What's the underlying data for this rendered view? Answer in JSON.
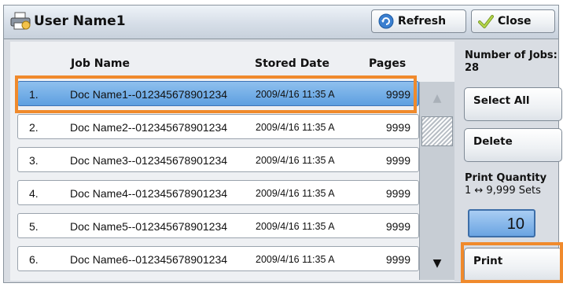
{
  "window": {
    "title": "User Name1"
  },
  "toolbar": {
    "refresh_label": "Refresh",
    "close_label": "Close"
  },
  "table": {
    "columns": {
      "job_name": "Job Name",
      "stored_date": "Stored Date",
      "pages": "Pages"
    },
    "rows": [
      {
        "num": "1.",
        "name": "Doc Name1--012345678901234",
        "date": "2009/4/16 11:35 A",
        "pages": "9999",
        "selected": true
      },
      {
        "num": "2.",
        "name": "Doc Name2--012345678901234",
        "date": "2009/4/16 11:35 A",
        "pages": "9999",
        "selected": false
      },
      {
        "num": "3.",
        "name": "Doc Name3--012345678901234",
        "date": "2009/4/16 11:35 A",
        "pages": "9999",
        "selected": false
      },
      {
        "num": "4.",
        "name": "Doc Name4--012345678901234",
        "date": "2009/4/16 11:35 A",
        "pages": "9999",
        "selected": false
      },
      {
        "num": "5.",
        "name": "Doc Name5--012345678901234",
        "date": "2009/4/16 11:35 A",
        "pages": "9999",
        "selected": false
      },
      {
        "num": "6.",
        "name": "Doc Name6--012345678901234",
        "date": "2009/4/16 11:35 A",
        "pages": "9999",
        "selected": false
      }
    ]
  },
  "side": {
    "jobs_label": "Number of Jobs:",
    "jobs_count": "28",
    "select_all_label": "Select All",
    "delete_label": "Delete",
    "print_qty_label": "Print Quantity",
    "print_qty_range": "1 ↔ 9,999 Sets",
    "print_qty_value": "10",
    "print_label": "Print"
  },
  "icons": {
    "printer": "printer-icon",
    "refresh": "refresh-icon",
    "close": "checkmark-icon",
    "scroll_up": "triangle-up-icon",
    "scroll_down": "triangle-down-icon"
  },
  "colors": {
    "highlight": "#f08a2c",
    "selected_row": "#5d9fe0"
  }
}
